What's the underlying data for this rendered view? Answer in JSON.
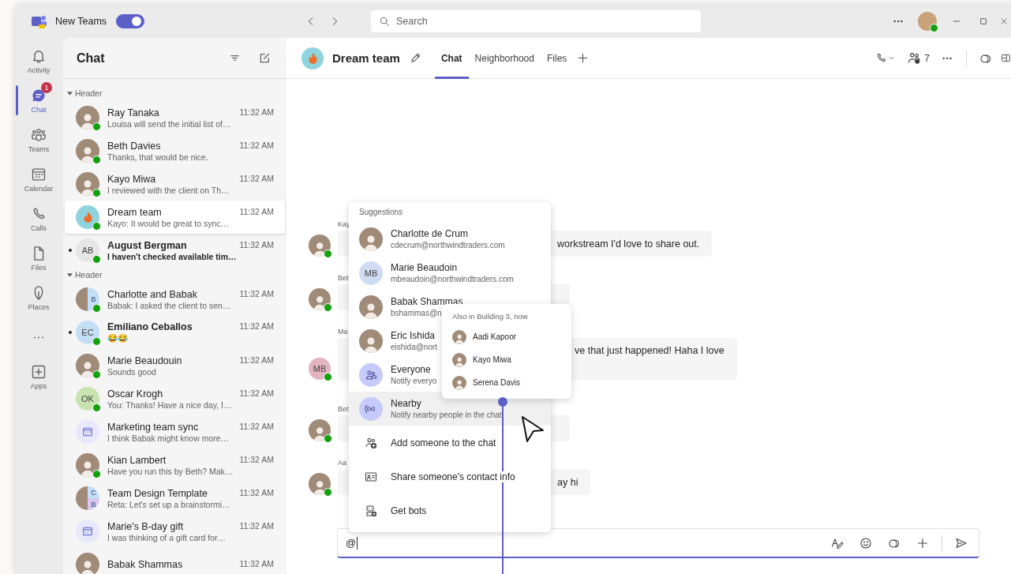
{
  "title_bar": {
    "app_name": "New Teams",
    "new_teams_toggle": {
      "on": true
    },
    "search": {
      "placeholder": "Search"
    }
  },
  "rail": [
    {
      "label": "Activity",
      "selected": false
    },
    {
      "label": "Chat",
      "selected": true,
      "badge": "1"
    },
    {
      "label": "Teams",
      "selected": false
    },
    {
      "label": "Calendar",
      "selected": false
    },
    {
      "label": "Calls",
      "selected": false
    },
    {
      "label": "Files",
      "selected": false
    },
    {
      "label": "Places",
      "selected": false
    },
    {
      "selected": false
    },
    {
      "label": "Apps",
      "selected": false
    }
  ],
  "chat_list": {
    "title": "Chat",
    "sections": [
      {
        "header": "Header",
        "expanded": true,
        "chats": [
          {
            "name": "Ray Tanaka",
            "preview": "Louisa will send the initial list of…",
            "time": "11:32 AM",
            "avatar": {
              "kind": "photo"
            },
            "online": true,
            "unread": false,
            "selected": false
          },
          {
            "name": "Beth Davies",
            "preview": "Thanks, that would be nice.",
            "time": "11:32 AM",
            "avatar": {
              "kind": "photo"
            },
            "online": true,
            "unread": false,
            "selected": false
          },
          {
            "name": "Kayo Miwa",
            "preview": "I reviewed with the client on Th…",
            "time": "11:32 AM",
            "avatar": {
              "kind": "photo"
            },
            "online": true,
            "unread": false,
            "selected": false
          },
          {
            "name": "Dream team",
            "preview": "Kayo: It would be great to sync…",
            "time": "11:32 AM",
            "avatar": {
              "kind": "team"
            },
            "online": true,
            "unread": false,
            "selected": true
          },
          {
            "name": "August Bergman",
            "preview": "I haven't checked available tim…",
            "time": "11:32 AM",
            "avatar": {
              "kind": "initials",
              "initials": "AB",
              "color": "#e6e6e6"
            },
            "online": true,
            "unread": true,
            "selected": false
          }
        ]
      },
      {
        "header": "Header",
        "expanded": true,
        "chats": [
          {
            "name": "Charlotte and Babak",
            "preview": "Babak: I asked the client to sen…",
            "time": "11:32 AM",
            "avatar": {
              "kind": "group",
              "initials": [
                "B"
              ]
            },
            "online": true,
            "unread": false,
            "selected": false
          },
          {
            "name": "Emiliano Ceballos",
            "preview": "😂😂",
            "time": "11:32 AM",
            "avatar": {
              "kind": "initials",
              "initials": "EC",
              "color": "#c4def5"
            },
            "online": true,
            "unread": true,
            "selected": false
          },
          {
            "name": "Marie Beaudouin",
            "preview": "Sounds good",
            "time": "11:32 AM",
            "avatar": {
              "kind": "photo"
            },
            "online": true,
            "unread": false,
            "selected": false
          },
          {
            "name": "Oscar Krogh",
            "preview": "You: Thanks! Have a nice day, I…",
            "time": "11:32 AM",
            "avatar": {
              "kind": "initials",
              "initials": "OK",
              "color": "#c8e3b0"
            },
            "online": true,
            "unread": false,
            "selected": false
          },
          {
            "name": "Marketing team sync",
            "preview": "I think Babak might know more…",
            "time": "11:32 AM",
            "avatar": {
              "kind": "meeting"
            },
            "unread": false,
            "selected": false
          },
          {
            "name": "Kian Lambert",
            "preview": "Have you run this by Beth? Mak…",
            "time": "11:32 AM",
            "avatar": {
              "kind": "photo"
            },
            "online": true,
            "unread": false,
            "selected": false
          },
          {
            "name": "Team Design Template",
            "preview": "Reta: Let's set up a brainstormi…",
            "time": "11:32 AM",
            "avatar": {
              "kind": "group",
              "initials": [
                "C",
                "B"
              ]
            },
            "unread": false,
            "selected": false
          },
          {
            "name": "Marie's B-day gift",
            "preview": "I was thinking of a gift card for…",
            "time": "11:32 AM",
            "avatar": {
              "kind": "meeting"
            },
            "unread": false,
            "selected": false
          },
          {
            "name": "Babak Shammas",
            "time": "11:32 AM",
            "avatar": {
              "kind": "photo"
            },
            "unread": false,
            "selected": false
          }
        ]
      }
    ]
  },
  "conversation": {
    "title": "Dream team",
    "tabs": [
      {
        "label": "Chat",
        "selected": true
      },
      {
        "label": "Neighborhood",
        "selected": false
      },
      {
        "label": "Files",
        "selected": false
      }
    ],
    "participant_count": "7",
    "messages": [
      {
        "sender": "Kay",
        "text": "workstream I'd love to share out.",
        "avatar": {
          "kind": "photo"
        },
        "online": true
      },
      {
        "sender": "Bet",
        "avatar": {
          "kind": "photo"
        },
        "online": true
      },
      {
        "sender": "Ma",
        "text": "ve that just happened! Haha I love",
        "avatar": {
          "kind": "initials",
          "initials": "MB",
          "color": "#e3b4c0"
        },
        "online": true
      },
      {
        "sender": "Bet",
        "avatar": {
          "kind": "photo"
        },
        "online": true
      },
      {
        "sender": "Aa",
        "text": "ay hi",
        "avatar": {
          "kind": "photo"
        },
        "online": true
      }
    ],
    "compose": {
      "value": "@"
    }
  },
  "mention_popup": {
    "header": "Suggestions",
    "items": [
      {
        "kind": "person",
        "name": "Charlotte de Crum",
        "detail": "cdecrum@northwindtraders.com",
        "avatar": {
          "kind": "photo"
        },
        "selected": false
      },
      {
        "kind": "person",
        "name": "Marie Beaudoin",
        "detail": "mbeaudoin@northwindtraders.com",
        "avatar": {
          "kind": "initials",
          "initials": "MB",
          "color": "#cfdcf2"
        },
        "selected": false
      },
      {
        "kind": "person",
        "name": "Babak Shammas",
        "detail": "bshammas@n",
        "avatar": {
          "kind": "photo"
        },
        "selected": false
      },
      {
        "kind": "person",
        "name": "Eric Ishida",
        "detail": "eishida@nort",
        "avatar": {
          "kind": "photo"
        },
        "selected": false
      },
      {
        "kind": "group",
        "name": "Everyone",
        "detail": "Notify everyo",
        "selected": false
      },
      {
        "kind": "group",
        "name": "Nearby",
        "detail": "Notify nearby people in the chat",
        "selected": true
      },
      {
        "kind": "action",
        "name": "Add someone to the chat",
        "selected": false
      },
      {
        "kind": "action",
        "name": "Share someone's contact info",
        "selected": false
      },
      {
        "kind": "action",
        "name": "Get bots",
        "selected": false
      }
    ]
  },
  "nearby_popup": {
    "header": "Also in Building 3, now",
    "people": [
      {
        "name": "Aadi Kapoor"
      },
      {
        "name": "Kayo Miwa"
      },
      {
        "name": "Serena Davis"
      }
    ]
  }
}
